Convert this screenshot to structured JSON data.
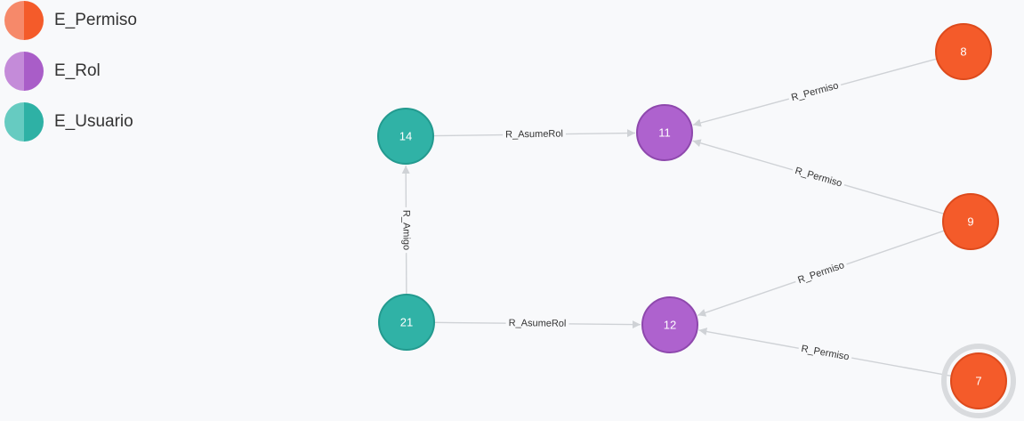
{
  "legend": [
    {
      "label": "E_Permiso",
      "color_light": "#f6896a",
      "color": "#f45b2a"
    },
    {
      "label": "E_Rol",
      "color_light": "#c48bd9",
      "color": "#a95dc8"
    },
    {
      "label": "E_Usuario",
      "color_light": "#66cbc1",
      "color": "#2eb1a5"
    }
  ],
  "node_styles": {
    "E_Permiso": {
      "fill": "#f45b2a",
      "stroke": "#dd4a1c"
    },
    "E_Rol": {
      "fill": "#ae62ce",
      "stroke": "#8e48ad"
    },
    "E_Usuario": {
      "fill": "#30b2a6",
      "stroke": "#239a8f"
    }
  },
  "nodes": [
    {
      "id": "14",
      "label": "14",
      "type": "E_Usuario"
    },
    {
      "id": "21",
      "label": "21",
      "type": "E_Usuario"
    },
    {
      "id": "11",
      "label": "11",
      "type": "E_Rol"
    },
    {
      "id": "12",
      "label": "12",
      "type": "E_Rol"
    },
    {
      "id": "8",
      "label": "8",
      "type": "E_Permiso"
    },
    {
      "id": "9",
      "label": "9",
      "type": "E_Permiso"
    },
    {
      "id": "7",
      "label": "7",
      "type": "E_Permiso",
      "selected": true
    }
  ],
  "edges": [
    {
      "from": "14",
      "to": "11",
      "label": "R_AsumeRol"
    },
    {
      "from": "21",
      "to": "12",
      "label": "R_AsumeRol"
    },
    {
      "from": "21",
      "to": "14",
      "label": "R_Amigo"
    },
    {
      "from": "8",
      "to": "11",
      "label": "R_Permiso"
    },
    {
      "from": "9",
      "to": "11",
      "label": "R_Permiso"
    },
    {
      "from": "9",
      "to": "12",
      "label": "R_Permiso"
    },
    {
      "from": "7",
      "to": "12",
      "label": "R_Permiso"
    }
  ]
}
